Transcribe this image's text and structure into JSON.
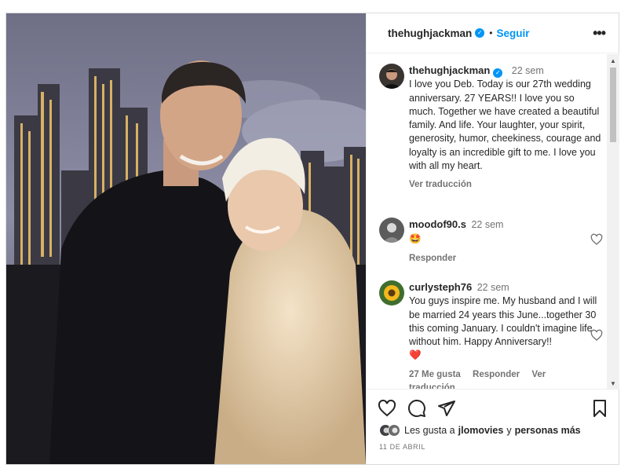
{
  "post": {
    "author": "thehughjackman",
    "follow_label": "Seguir",
    "more_label": "•••"
  },
  "caption": {
    "author": "thehughjackman",
    "time": "22 sem",
    "text": "I love you Deb. Today is our 27th wedding anniversary. 27 YEARS!! I love you so much. Together we have created a beautiful family. And life. Your laughter, your spirit, generosity, humor, cheekiness, courage and loyalty is an incredible gift to me. I love you with all my heart.",
    "translate_label": "Ver traducción"
  },
  "comments": [
    {
      "author": "moodof90.s",
      "time": "22 sem",
      "text": "🤩",
      "reply_label": "Responder"
    },
    {
      "author": "curlysteph76",
      "time": "22 sem",
      "text": "You guys inspire me. My husband and I will be married 24 years this June...together 30 this coming January. I couldn't imagine life without him. Happy Anniversary!!",
      "emoji": "❤️",
      "likes_label": "27 Me gusta",
      "reply_label": "Responder",
      "translate_label": "Ver traducción"
    }
  ],
  "likes": {
    "prefix": "Les gusta a",
    "user": "jlomovies",
    "connector": "y",
    "others": "personas más"
  },
  "date": "11 DE ABRIL",
  "icons": {
    "verified": "verified-badge-icon",
    "like": "heart-icon",
    "comment": "comment-icon",
    "share": "send-icon",
    "save": "bookmark-icon"
  },
  "colors": {
    "accent": "#0095f6",
    "text": "#262626",
    "muted": "#737373"
  }
}
